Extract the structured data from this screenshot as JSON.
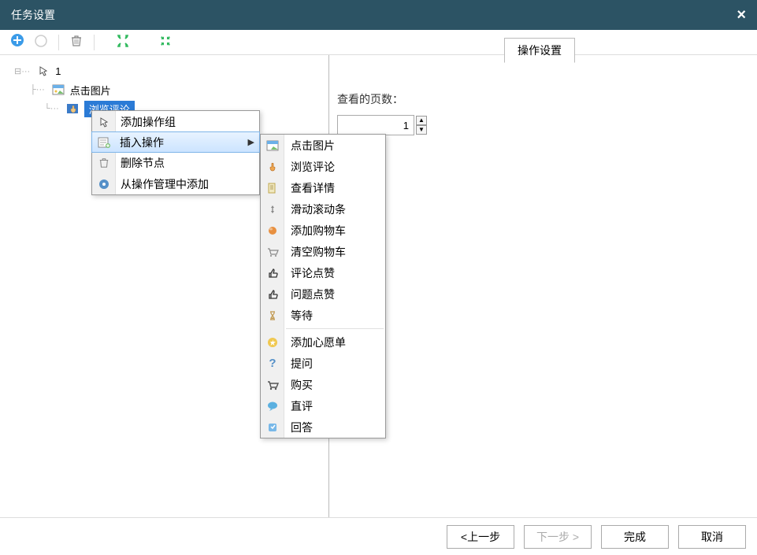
{
  "titlebar": {
    "title": "任务设置",
    "close": "×"
  },
  "tree": {
    "root": "1",
    "item1": "点击图片",
    "item2": "浏览评论"
  },
  "context_menu": {
    "add_group": "添加操作组",
    "insert_op": "插入操作",
    "delete_node": "删除节点",
    "add_from_mgmt": "从操作管理中添加"
  },
  "submenu": {
    "click_image": "点击图片",
    "browse_comments": "浏览评论",
    "view_details": "查看详情",
    "scroll": "滑动滚动条",
    "add_cart": "添加购物车",
    "clear_cart": "清空购物车",
    "like_comment": "评论点赞",
    "like_question": "问题点赞",
    "wait": "等待",
    "add_wishlist": "添加心愿单",
    "ask": "提问",
    "buy": "购买",
    "direct_comment": "直评",
    "answer": "回答"
  },
  "right_panel": {
    "tab": "操作设置",
    "pages_label": "查看的页数：",
    "pages_value": "1"
  },
  "footer": {
    "prev": "<上一步",
    "next": "下一步 >",
    "finish": "完成",
    "cancel": "取消"
  }
}
